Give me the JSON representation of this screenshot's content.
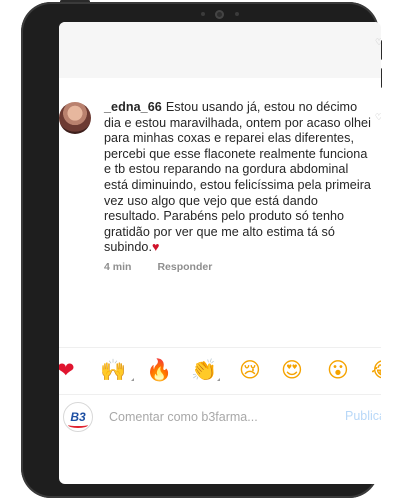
{
  "comment": {
    "username": "_edna_66",
    "text": "Estou usando já, estou no décimo dia e estou maravilhada, ontem por acaso olhei para minhas coxas e reparei elas diferentes, percebi que esse flaconete realmente funciona e tb estou reparando na gordura abdominal está diminuindo, estou felicíssima pela primeira vez uso algo que vejo que está dando resultado. Parabéns pelo produto só tenho gratidão por ver que me alto estima tá só subindo.",
    "trailing_emoji": "♥",
    "time": "4 min",
    "reply_label": "Responder"
  },
  "reactions": [
    "❤",
    "🙌",
    "🔥",
    "👏",
    "😢",
    "😍",
    "😮",
    "😂"
  ],
  "composer": {
    "avatar_text": "B3",
    "placeholder": "Comentar como b3farma...",
    "publish_label": "Publicar"
  },
  "colors": {
    "text": "#262626",
    "muted": "#8e8e8e",
    "publish_disabled": "#b8d8f8",
    "heart": "#d0132b"
  }
}
